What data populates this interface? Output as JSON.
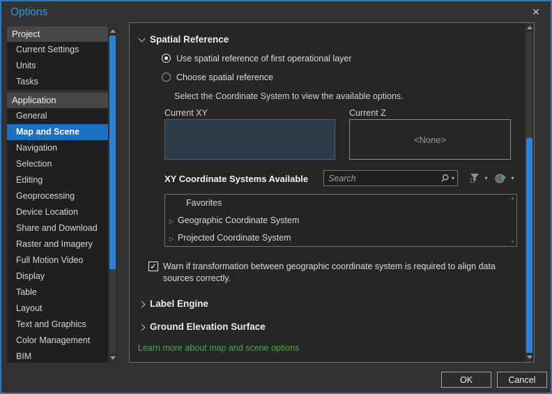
{
  "window": {
    "title": "Options"
  },
  "icons": {
    "close": "✕",
    "check": "✓",
    "caret": "▾",
    "expander": "▷",
    "mini_up": "▲",
    "mini_down": "▼"
  },
  "sidebar": {
    "groups": [
      {
        "label": "Project",
        "items": [
          {
            "label": "Current Settings"
          },
          {
            "label": "Units"
          },
          {
            "label": "Tasks"
          }
        ]
      },
      {
        "label": "Application",
        "items": [
          {
            "label": "General"
          },
          {
            "label": "Map and Scene",
            "selected": true
          },
          {
            "label": "Navigation"
          },
          {
            "label": "Selection"
          },
          {
            "label": "Editing"
          },
          {
            "label": "Geoprocessing"
          },
          {
            "label": "Device Location"
          },
          {
            "label": "Share and Download"
          },
          {
            "label": "Raster and Imagery"
          },
          {
            "label": "Full Motion Video"
          },
          {
            "label": "Display"
          },
          {
            "label": "Table"
          },
          {
            "label": "Layout"
          },
          {
            "label": "Text and Graphics"
          },
          {
            "label": "Color Management"
          },
          {
            "label": "BIM"
          }
        ]
      }
    ]
  },
  "main": {
    "spatial_reference": {
      "title": "Spatial Reference",
      "radio_use_first_label": "Use spatial reference of first operational layer",
      "radio_use_first_selected": true,
      "radio_choose_label": "Choose spatial reference",
      "radio_choose_selected": false,
      "select_hint": "Select the Coordinate System to view the available options.",
      "current_xy_label": "Current XY",
      "current_z_label": "Current Z",
      "current_z_value": "<None>",
      "xy_available_label": "XY Coordinate Systems Available",
      "search_placeholder": "Search",
      "list_items": [
        {
          "label": "Favorites",
          "expandable": false
        },
        {
          "label": "Geographic Coordinate System",
          "expandable": true
        },
        {
          "label": "Projected Coordinate System",
          "expandable": true
        }
      ],
      "warn_checkbox_label": "Warn if transformation between geographic coordinate system is required to align data sources correctly.",
      "warn_checked": true
    },
    "label_engine_title": "Label Engine",
    "ground_elevation_title": "Ground Elevation Surface",
    "learn_more": "Learn more about map and scene options"
  },
  "footer": {
    "ok_label": "OK",
    "cancel_label": "Cancel"
  },
  "colors": {
    "window_border": "#2779c4",
    "title_text": "#3796e0",
    "selected_item": "#1d6fbf",
    "scroll_thumb": "#2e7fd6",
    "link_green": "#4ca64c",
    "current_xy_fill": "#2d3c48",
    "panel_bg": "#262626",
    "sidebar_bg": "#1f1f1f"
  }
}
